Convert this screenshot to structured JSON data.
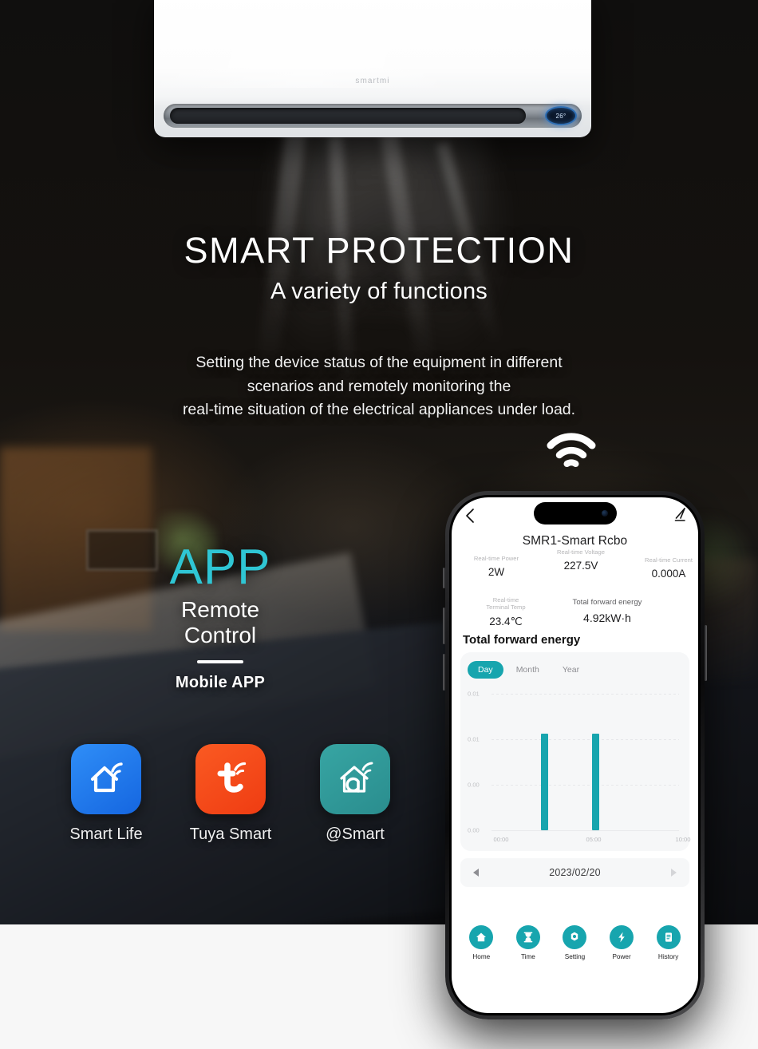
{
  "hero": {
    "ac_unit": {
      "brand": "smartmi",
      "display_temp": "26°"
    },
    "title_main": "SMART PROTECTION",
    "title_sub": "A variety of functions",
    "description_lines": [
      "Setting the device status of the equipment in different",
      "scenarios and remotely monitoring the",
      "real-time situation of the electrical appliances under load."
    ],
    "wifi_icon": "wifi-icon"
  },
  "app_promo": {
    "word": "APP",
    "remote_line1": "Remote",
    "remote_line2": "Control",
    "mobile_label": "Mobile APP",
    "accent_color": "#2fc6d4"
  },
  "app_icons": [
    {
      "label": "Smart Life",
      "icon": "house-wifi-icon",
      "color": "#1f7ff5",
      "color2": "#2f8ef7"
    },
    {
      "label": "Tuya Smart",
      "icon": "tuya-t-wifi-icon",
      "color": "#f4441e",
      "color2": "#fa5a22"
    },
    {
      "label": "@Smart",
      "icon": "house-a-wifi-icon",
      "color": "#2f9a9b",
      "color2": "#37a5a3"
    }
  ],
  "phone": {
    "topbar": {
      "back_icon": "back-chevron-icon",
      "edit_icon": "edit-pencil-icon"
    },
    "device_title": "SMR1-Smart Rcbo",
    "metrics": [
      {
        "label": "Real-time Power",
        "value": "2W"
      },
      {
        "label": "Real-time Voltage",
        "value": "227.5V"
      },
      {
        "label": "Real-time Current",
        "value": "0.000A"
      },
      {
        "label": "Real-time\nTerminal Temp",
        "label_l1": "Real-time",
        "label_l2": "Terminal Temp",
        "value": "23.4℃"
      },
      {
        "label": "Total forward energy",
        "value": "4.92kW·h"
      }
    ],
    "chart_heading": "Total forward energy",
    "range_tabs": [
      {
        "label": "Day",
        "active": true
      },
      {
        "label": "Month",
        "active": false
      },
      {
        "label": "Year",
        "active": false
      }
    ],
    "date_nav": {
      "date": "2023/02/20",
      "prev_icon": "triangle-left-icon",
      "next_icon": "triangle-right-icon"
    },
    "bottom_nav": [
      {
        "label": "Home",
        "icon": "home-icon"
      },
      {
        "label": "Time",
        "icon": "hourglass-icon"
      },
      {
        "label": "Setting",
        "icon": "gear-icon"
      },
      {
        "label": "Power",
        "icon": "lightning-bolt-icon"
      },
      {
        "label": "History",
        "icon": "document-list-icon"
      }
    ],
    "accent_color": "#17a5ae"
  },
  "chart_data": {
    "type": "bar",
    "title": "Total forward energy",
    "xlabel": "",
    "ylabel": "",
    "x_ticks": [
      "00:00",
      "05:00",
      "10:00"
    ],
    "y_ticks": [
      "0.01",
      "0.01",
      "0.00",
      "0.00"
    ],
    "ylim": [
      0,
      0.012
    ],
    "grid": true,
    "legend": "none",
    "bar_color": "#17a5ae",
    "categories": [
      "03:00",
      "06:00"
    ],
    "values": [
      0.0085,
      0.0085
    ],
    "selected_range": "Day",
    "date": "2023/02/20"
  }
}
